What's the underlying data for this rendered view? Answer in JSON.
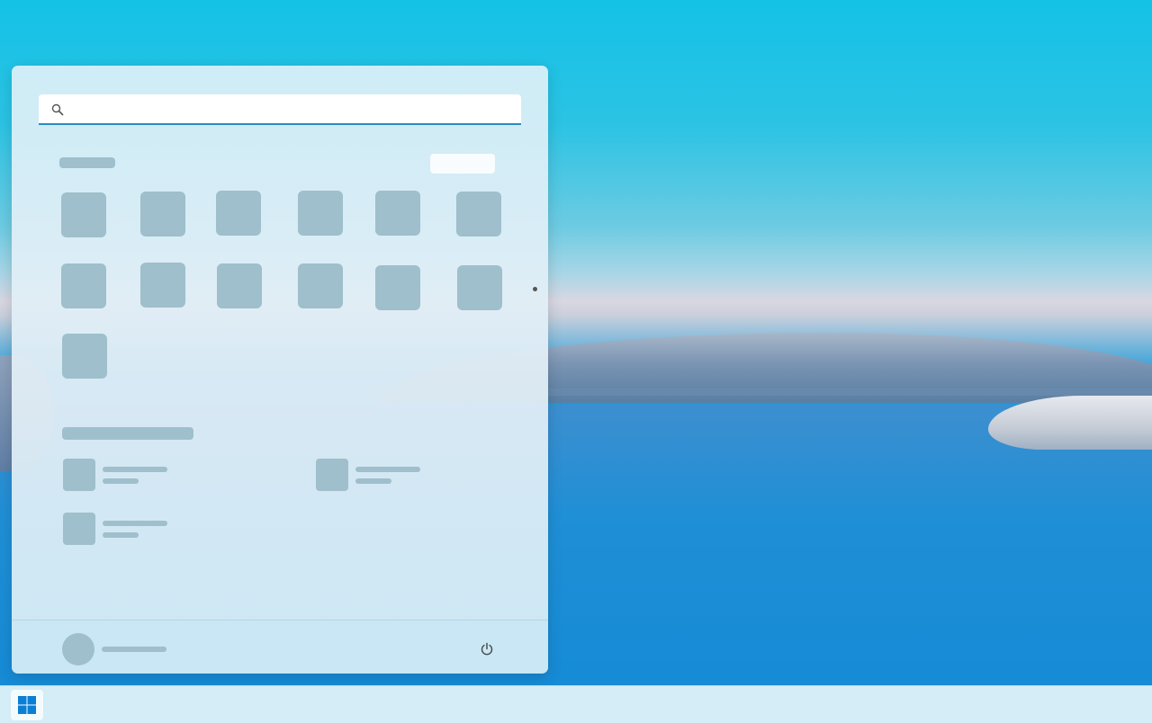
{
  "start_menu": {
    "search": {
      "placeholder": "",
      "value": "",
      "icon": "search-icon"
    },
    "pinned": {
      "tile_count": 13
    },
    "recommended": {
      "item_count": 3
    },
    "footer": {
      "user_icon": "avatar",
      "power_icon": "power-icon"
    }
  },
  "taskbar": {
    "start_icon": "windows-logo-icon",
    "accent_color": "#0a7fd4"
  },
  "colors": {
    "accent": "#2a8cbf",
    "placeholder_block": "#9ebfcb",
    "menu_background": "#dff0f7"
  }
}
